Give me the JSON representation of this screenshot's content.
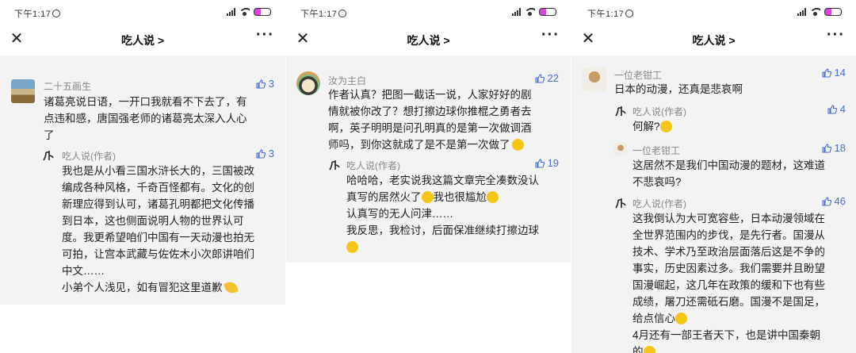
{
  "status": {
    "time": "下午1:17"
  },
  "nav": {
    "title": "吃人说 >"
  },
  "panel1": {
    "c1": {
      "name": "二十五画生",
      "likes": "3",
      "lines": [
        "诸葛亮说日语，一开口我就看不下去了，有",
        "点违和感，唐国强老师的诸葛亮太深入人心",
        "了"
      ]
    },
    "r1": {
      "name": "吃人说(作者)",
      "likes": "3",
      "lines": [
        "我也是从小看三国水浒长大的，三国被改",
        "编成各种风格，千奇百怪都有。文化的创",
        "新理应得到认可，诸葛孔明都把文化传播",
        "到日本，这也侧面说明人物的世界认可",
        "度。我更希望咱们中国有一天动漫也拍无",
        "可拍，让宫本武藏与佐佐木小次郎讲咱们",
        "中文……",
        "小弟个人浅见，如有冒犯这里道歉"
      ]
    }
  },
  "panel2": {
    "c1": {
      "name": "汝为主白",
      "likes": "22",
      "lines": [
        "作者认真？把图一截话一说，人家好好的剧",
        "情就被你改了？想打擦边球你推棍之勇者去",
        "啊，英子明明是问孔明真的是第一次做调酒",
        "师吗，到你这就成了是不是第一次做了"
      ]
    },
    "r1": {
      "name": "吃人说(作者)",
      "likes": "19",
      "lines": [
        "哈哈哈，老实说我这篇文章完全凑数没认",
        "真写的居然火了",
        "我也很尴尬",
        "认真写的无人问津……",
        "我反思，我检讨，后面保准继续打擦边球"
      ]
    }
  },
  "panel3": {
    "c1": {
      "name": "一位老钳工",
      "likes": "14",
      "lines": [
        "日本的动漫，还真是悲哀啊"
      ]
    },
    "r1": {
      "name": "吃人说(作者)",
      "likes": "4",
      "lines": [
        "何解?"
      ]
    },
    "r2": {
      "name": "一位老钳工",
      "likes": "18",
      "lines": [
        "这居然不是我们中国动漫的题材，这难道",
        "不悲哀吗?"
      ]
    },
    "r3": {
      "name": "吃人说(作者)",
      "likes": "46",
      "lines": [
        "这我倒认为大可宽容些，日本动漫领域在",
        "全世界范围内的步伐，是先行者。国漫从",
        "技术、学术乃至政治层面落后这是不争的",
        "事实，历史因素过多。我们需要并且盼望",
        "国漫崛起，这几年在政策的缓和下也有些",
        "成绩，屠刀还需砥石磨。国漫不是国足，",
        "给点信心",
        "4月还有一部王者天下，也是讲中国秦朝",
        "的"
      ]
    }
  }
}
